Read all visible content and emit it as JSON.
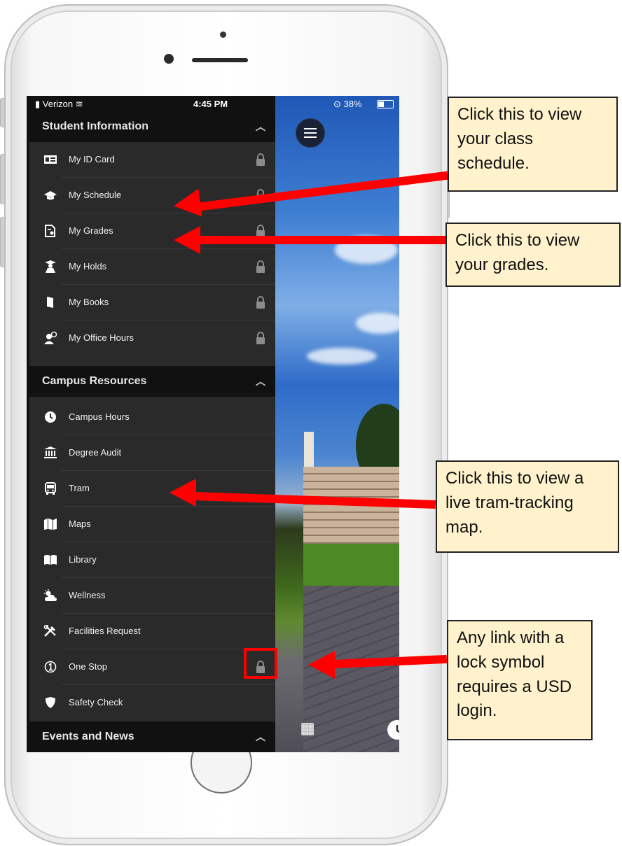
{
  "status_bar": {
    "carrier": "Verizon",
    "time": "4:45 PM",
    "battery": "38%"
  },
  "sections": [
    {
      "title": "Student Information",
      "items": [
        {
          "label": "My ID Card",
          "icon": "id-card-icon",
          "locked": true
        },
        {
          "label": "My Schedule",
          "icon": "graduation-cap-icon",
          "locked": true
        },
        {
          "label": "My Grades",
          "icon": "grades-document-icon",
          "locked": true
        },
        {
          "label": "My Holds",
          "icon": "holds-person-icon",
          "locked": true
        },
        {
          "label": "My Books",
          "icon": "book-icon",
          "locked": true
        },
        {
          "label": "My Office Hours",
          "icon": "office-hours-icon",
          "locked": true
        }
      ]
    },
    {
      "title": "Campus Resources",
      "items": [
        {
          "label": "Campus Hours",
          "icon": "clock-icon",
          "locked": false
        },
        {
          "label": "Degree Audit",
          "icon": "bank-building-icon",
          "locked": false
        },
        {
          "label": "Tram",
          "icon": "bus-icon",
          "locked": false
        },
        {
          "label": "Maps",
          "icon": "map-icon",
          "locked": false
        },
        {
          "label": "Library",
          "icon": "open-book-icon",
          "locked": false
        },
        {
          "label": "Wellness",
          "icon": "weather-sun-cloud-icon",
          "locked": false
        },
        {
          "label": "Facilities Request",
          "icon": "tools-icon",
          "locked": false
        },
        {
          "label": "One Stop",
          "icon": "circled-one-icon",
          "locked": true
        },
        {
          "label": "Safety Check",
          "icon": "shield-icon",
          "locked": false
        }
      ]
    },
    {
      "title": "Events and News",
      "items": []
    }
  ],
  "callouts": {
    "schedule": "Click this to view your class schedule.",
    "grades": "Click this to view your grades.",
    "tram": "Click this to view a live tram-tracking map.",
    "lock": "Any link with a lock symbol requires a USD login."
  },
  "colors": {
    "arrow": "#ff0000",
    "callout_bg": "#fff2cc",
    "drawer_bg": "#2a2a2a",
    "header_bg": "#111111"
  }
}
